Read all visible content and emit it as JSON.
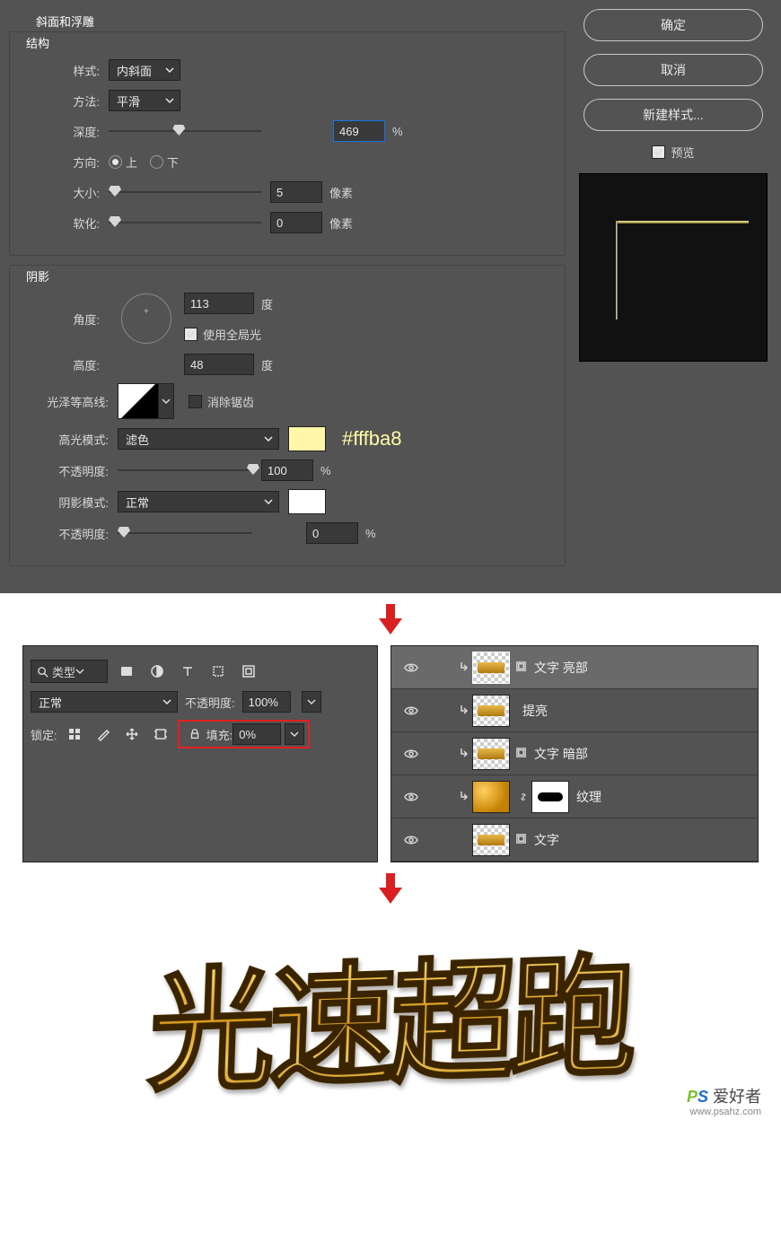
{
  "bevel": {
    "section": "斜面和浮雕",
    "structure_title": "结构",
    "style_label": "样式:",
    "style_value": "内斜面",
    "technique_label": "方法:",
    "technique_value": "平滑",
    "depth_label": "深度:",
    "depth_value": "469",
    "depth_unit": "%",
    "direction_label": "方向:",
    "direction_up": "上",
    "direction_down": "下",
    "size_label": "大小:",
    "size_value": "5",
    "size_unit": "像素",
    "soften_label": "软化:",
    "soften_value": "0",
    "soften_unit": "像素",
    "shading_title": "阴影",
    "angle_label": "角度:",
    "angle_value": "113",
    "angle_unit": "度",
    "global_light": "使用全局光",
    "altitude_label": "高度:",
    "altitude_value": "48",
    "altitude_unit": "度",
    "gloss_label": "光泽等高线:",
    "antialias": "消除锯齿",
    "hmode_label": "高光模式:",
    "hmode_value": "滤色",
    "color_note": "#fffba8",
    "hopacity_label": "不透明度:",
    "hopacity_value": "100",
    "hopacity_unit": "%",
    "smode_label": "阴影模式:",
    "smode_value": "正常",
    "sopacity_label": "不透明度:",
    "sopacity_value": "0",
    "sopacity_unit": "%"
  },
  "buttons": {
    "ok": "确定",
    "cancel": "取消",
    "new_style": "新建样式...",
    "preview": "预览"
  },
  "layers_panel": {
    "type_label": "类型",
    "blend": "正常",
    "opacity_label": "不透明度:",
    "opacity_value": "100%",
    "lock_label": "锁定:",
    "fill_label": "填充:",
    "fill_value": "0%"
  },
  "layers": {
    "l1": "文字 亮部",
    "l2": "提亮",
    "l3": "文字 暗部",
    "l4": "纹理",
    "l5": "文字"
  },
  "result_text": "光速超跑",
  "watermark": {
    "brand_p": "P",
    "brand_s": "S",
    "brand_txt": " 爱好者",
    "url": "www.psahz.com"
  }
}
